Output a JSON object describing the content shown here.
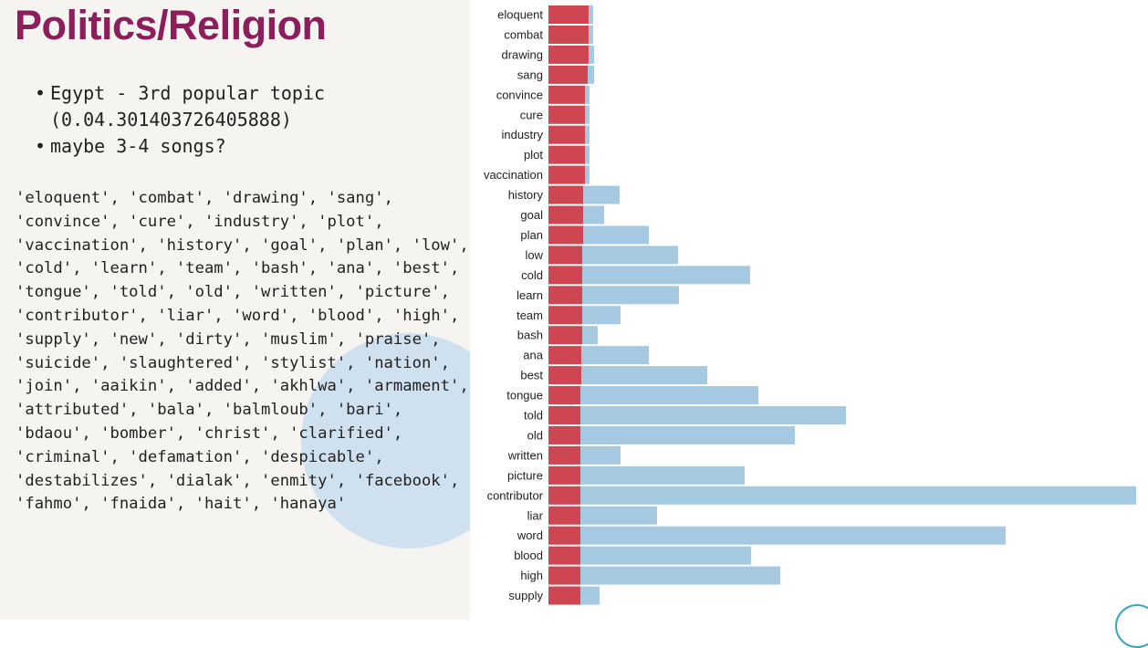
{
  "slide": {
    "title": "Politics/Religion",
    "bullets": [
      "Egypt - 3rd popular topic\n(0.04.301403726405888)",
      "maybe 3-4 songs?"
    ],
    "word_list": "'eloquent', 'combat', 'drawing', 'sang', 'convince', 'cure', 'industry', 'plot', 'vaccination', 'history', 'goal', 'plan', 'low', 'cold', 'learn', 'team', 'bash', 'ana', 'best', 'tongue', 'told', 'old', 'written', 'picture', 'contributor', 'liar', 'word', 'blood', 'high', 'supply', 'new', 'dirty', 'muslim', 'praise', 'suicide', 'slaughtered', 'stylist', 'nation', 'join', 'aaikin', 'added', 'akhlwa', 'armament', 'attributed', 'bala', 'balmloub', 'bari', 'bdaou', 'bomber', 'christ', 'clarified', 'criminal', 'defamation', 'despicable', 'destabilizes', 'dialak', 'enmity', 'facebook', 'fahmo', 'fnaida', 'hait', 'hanaya'"
  },
  "colors": {
    "title": "#8b1e5b",
    "topic_bar": "#cd4651",
    "overall_bar": "#a6c9e2",
    "panel_bg": "#f6f4f1",
    "circle": "#cfe0ee",
    "corner_ring": "#3aa7b9"
  },
  "chart_data": {
    "type": "bar",
    "orientation": "horizontal",
    "stacked": true,
    "categories": [
      "eloquent",
      "combat",
      "drawing",
      "sang",
      "convince",
      "cure",
      "industry",
      "plot",
      "vaccination",
      "history",
      "goal",
      "plan",
      "low",
      "cold",
      "learn",
      "team",
      "bash",
      "ana",
      "best",
      "tongue",
      "told",
      "old",
      "written",
      "picture",
      "contributor",
      "liar",
      "word",
      "blood",
      "high",
      "supply"
    ],
    "series": [
      {
        "values": [
          44,
          44,
          44,
          43,
          40,
          40,
          40,
          40,
          40,
          38,
          38,
          38,
          37,
          37,
          37,
          37,
          37,
          36,
          36,
          35,
          35,
          35,
          35,
          35,
          35,
          35,
          35,
          35,
          35,
          35
        ]
      },
      {
        "values": [
          5,
          5,
          6,
          7,
          5,
          5,
          5,
          5,
          5,
          40,
          23,
          72,
          105,
          184,
          106,
          42,
          17,
          74,
          138,
          195,
          291,
          235,
          44,
          180,
          609,
          84,
          466,
          187,
          219,
          21
        ]
      }
    ],
    "xlim": [
      0,
      645
    ],
    "grid": false
  }
}
